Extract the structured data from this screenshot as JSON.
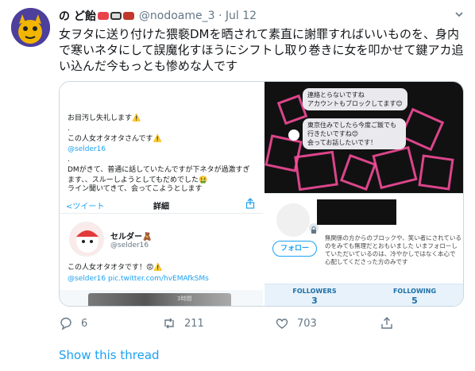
{
  "header": {
    "name": "の ど飴",
    "handle_time": "@nodoame_3 · Jul 12"
  },
  "tweet": {
    "text": "女ヲタに送り付けた猥褻DMを晒されて素直に謝罪すればいいものを、身内で寒いネタにして誤魔化すほうにシフトし取り巻きに女を叩かせて鍵アカ追い込んだ今もっとも惨めな人です"
  },
  "left_image": {
    "line1": "お目汚し失礼します⚠️",
    "dot1": ".",
    "line2": "この人女オタオタさんです⚠️",
    "link1": "@selder16",
    "dot2": ".",
    "line3": "DMがきて、普通に話していたんですが下ネタが過激すぎます、、スルーしようとしてもだめでした🤮",
    "line4": "ライン聞いてきて、会ってこようとします",
    "nav_back": "<ツイート",
    "nav_title": "詳細",
    "sub_name": "セルダー🧸",
    "sub_handle": "@selder16",
    "sub_text": "この人女オタオタです！😡⚠️",
    "sub_link": "@selder16 pic.twitter.com/hvEMAfkSMs",
    "bottom_label": "3時間"
  },
  "right_image": {
    "chat1": "連絡とらないですね\nアカウントもブロックしてます😊",
    "chat2": "東京住みでしたら今度ご飯でも行きたいですね😊\n会ってお話したいです！",
    "follow_label": "フォロー",
    "bio": "無関係の方からのブロックや、笑い者にされているのをみても無理だとおもいました いまフォローしていただいているのは、冷やかしではなく本心で心配してくださった方のみです",
    "followers_label": "FOLLOWERS",
    "followers_count": "3",
    "following_label": "FOLLOWING",
    "following_count": "5"
  },
  "actions": {
    "replies": "6",
    "retweets": "211",
    "likes": "703"
  },
  "show_thread": "Show this thread",
  "colors": {
    "accent": "#1da1f2",
    "muted": "#657786"
  }
}
